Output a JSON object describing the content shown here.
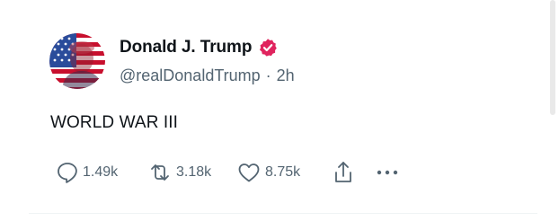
{
  "post": {
    "author": {
      "display_name": "Donald J. Trump",
      "handle": "@realDonaldTrump",
      "verified": true,
      "avatar_icon": "flag-portrait-avatar"
    },
    "separator": "·",
    "time": "2h",
    "text": "WORLD WAR III",
    "actions": {
      "replies": {
        "icon": "comment-icon",
        "count": "1.49k"
      },
      "reposts": {
        "icon": "repost-icon",
        "count": "3.18k"
      },
      "likes": {
        "icon": "heart-icon",
        "count": "8.75k"
      },
      "share": {
        "icon": "share-icon"
      },
      "more": {
        "icon": "more-dots-icon"
      }
    }
  },
  "colors": {
    "text_primary": "#0f1419",
    "text_secondary": "#536471",
    "verified_badge": "#e0245e",
    "flag_red": "#c8102e",
    "flag_blue": "#2a4c9b"
  }
}
